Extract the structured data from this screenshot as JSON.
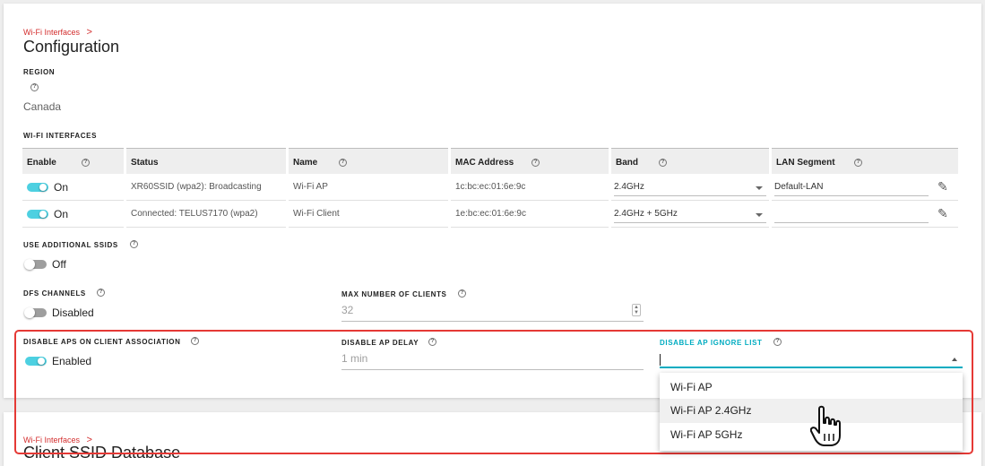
{
  "breadcrumb": {
    "label": "Wi-Fi Interfaces",
    "chevron": ">"
  },
  "page": {
    "title": "Configuration"
  },
  "region": {
    "label": "REGION",
    "help": "?",
    "value": "Canada"
  },
  "wifi_interfaces": {
    "label": "WI-FI INTERFACES",
    "headers": {
      "enable": "Enable",
      "status": "Status",
      "name": "Name",
      "mac": "MAC Address",
      "band": "Band",
      "lan": "LAN Segment"
    },
    "rows": [
      {
        "enable": "On",
        "status": "XR60SSID (wpa2): Broadcasting",
        "name": "Wi-Fi AP",
        "mac": "1c:bc:ec:01:6e:9c",
        "band": "2.4GHz",
        "lan": "Default-LAN"
      },
      {
        "enable": "On",
        "status": "Connected: TELUS7170 (wpa2)",
        "name": "Wi-Fi Client",
        "mac": "1e:bc:ec:01:6e:9c",
        "band": "2.4GHz + 5GHz",
        "lan": ""
      }
    ]
  },
  "additional_ssids": {
    "label": "USE ADDITIONAL SSIDS",
    "value": "Off"
  },
  "dfs": {
    "label": "DFS CHANNELS",
    "value": "Disabled"
  },
  "max_clients": {
    "label": "MAX NUMBER OF CLIENTS",
    "value": "32"
  },
  "disable_aps": {
    "label": "DISABLE APS ON CLIENT ASSOCIATION",
    "value": "Enabled"
  },
  "ap_delay": {
    "label": "DISABLE AP DELAY",
    "value": "1 min"
  },
  "ignore_list": {
    "label": "DISABLE AP IGNORE LIST",
    "options": [
      "Wi-Fi AP",
      "Wi-Fi AP 2.4GHz",
      "Wi-Fi AP 5GHz"
    ],
    "hovered_index": 1
  },
  "second_card": {
    "breadcrumb": "Wi-Fi Interfaces",
    "chevron": ">",
    "title": "Client SSID Database"
  },
  "colors": {
    "accent": "#4dd0e1",
    "highlight": "#e53935",
    "label_active": "#00acc1"
  },
  "icons": {
    "help": "question-circle-icon",
    "edit": "pencil-icon",
    "cursor": "hand-pointer-icon"
  }
}
